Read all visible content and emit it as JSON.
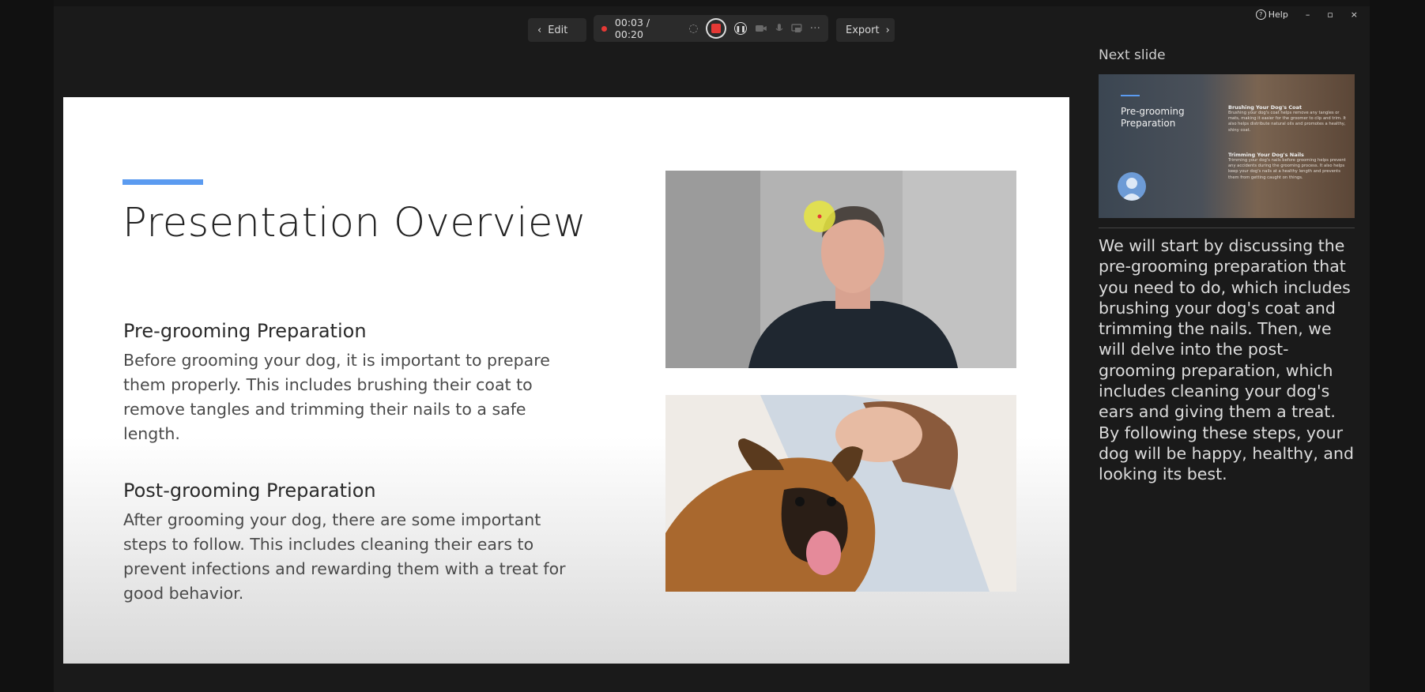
{
  "toolbar": {
    "edit_label": "Edit",
    "timer": "00:03 / 00:20",
    "export_label": "Export"
  },
  "window": {
    "help_label": "Help",
    "minimize_glyph": "–",
    "restore_glyph": "▫",
    "close_glyph": "×"
  },
  "slide": {
    "title": "Presentation Overview",
    "sections": [
      {
        "heading": "Pre-grooming Preparation",
        "body": "Before grooming your dog, it is important to prepare them properly. This includes brushing their coat to remove tangles and trimming their nails to a safe length."
      },
      {
        "heading": "Post-grooming Preparation",
        "body": "After grooming your dog, there are some important steps to follow. This includes cleaning their ears to prevent infections and rewarding them with a treat for good behavior."
      }
    ]
  },
  "next_slide": {
    "label": "Next slide",
    "title": "Pre-grooming Preparation",
    "col_items": [
      {
        "heading": "Brushing Your Dog's Coat",
        "body": "Brushing your dog's coat helps remove any tangles or mats, making it easier for the groomer to clip and trim. It also helps distribute natural oils and promotes a healthy, shiny coat."
      },
      {
        "heading": "Trimming Your Dog's Nails",
        "body": "Trimming your dog's nails before grooming helps prevent any accidents during the grooming process. It also helps keep your dog's nails at a healthy length and prevents them from getting caught on things."
      }
    ]
  },
  "notes": "We will start by discussing the pre-grooming preparation that you need to do, which includes brushing your dog's coat and trimming the nails. Then, we will delve into the post-grooming preparation, which includes cleaning your dog's ears and giving them a treat. By following these steps, your dog will be happy, healthy, and looking its best.",
  "colors": {
    "accent": "#5b9bf0",
    "record": "#e53935",
    "pointer": "#e8e640"
  },
  "icons": [
    "chevron-left-icon",
    "chevron-right-icon",
    "record-dot-icon",
    "stop-record-icon",
    "pause-icon",
    "camera-icon",
    "microphone-icon",
    "help-icon"
  ]
}
